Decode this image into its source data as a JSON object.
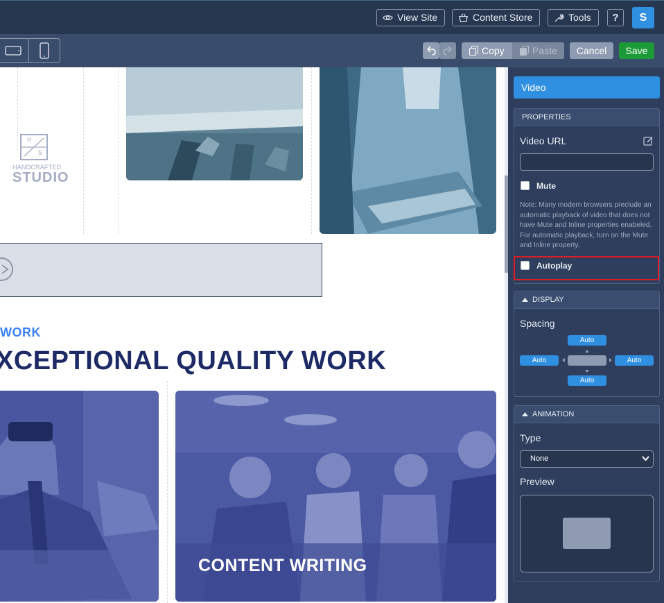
{
  "topbar": {
    "view_site": "View Site",
    "content_store": "Content Store",
    "tools": "Tools",
    "help": "?",
    "user_initial": "S"
  },
  "editbar": {
    "copy": "Copy",
    "paste": "Paste",
    "cancel": "Cancel",
    "save": "Save"
  },
  "canvas": {
    "logo_monogram": [
      "H",
      "S"
    ],
    "logo_line1": "HANDCRAFTED",
    "logo_line2": "STUDIO",
    "kicker": "WORK",
    "headline": "XCEPTIONAL QUALITY WORK",
    "card_caption": "CONTENT WRITING"
  },
  "panel": {
    "tab_label": "Video",
    "properties_header": "PROPERTIES",
    "video_url_label": "Video URL",
    "video_url_value": "",
    "mute_label": "Mute",
    "mute_checked": false,
    "note": "Note: Many modern browsers preclude an automatic playback of video that does not have Mute and Inline properties enabeled. For automatic playback, turn on the Mute and Inline property.",
    "autoplay_label": "Autoplay",
    "autoplay_checked": false,
    "display_header": "DISPLAY",
    "spacing_label": "Spacing",
    "spacing": {
      "top": "Auto",
      "left": "Auto",
      "right": "Auto",
      "bottom": "Auto"
    },
    "animation_header": "ANIMATION",
    "type_label": "Type",
    "type_value": "None",
    "preview_label": "Preview"
  },
  "colors": {
    "accent": "#2f8fe0",
    "save": "#1c9a37",
    "highlight": "#e01b24",
    "headline": "#1d2a66"
  }
}
